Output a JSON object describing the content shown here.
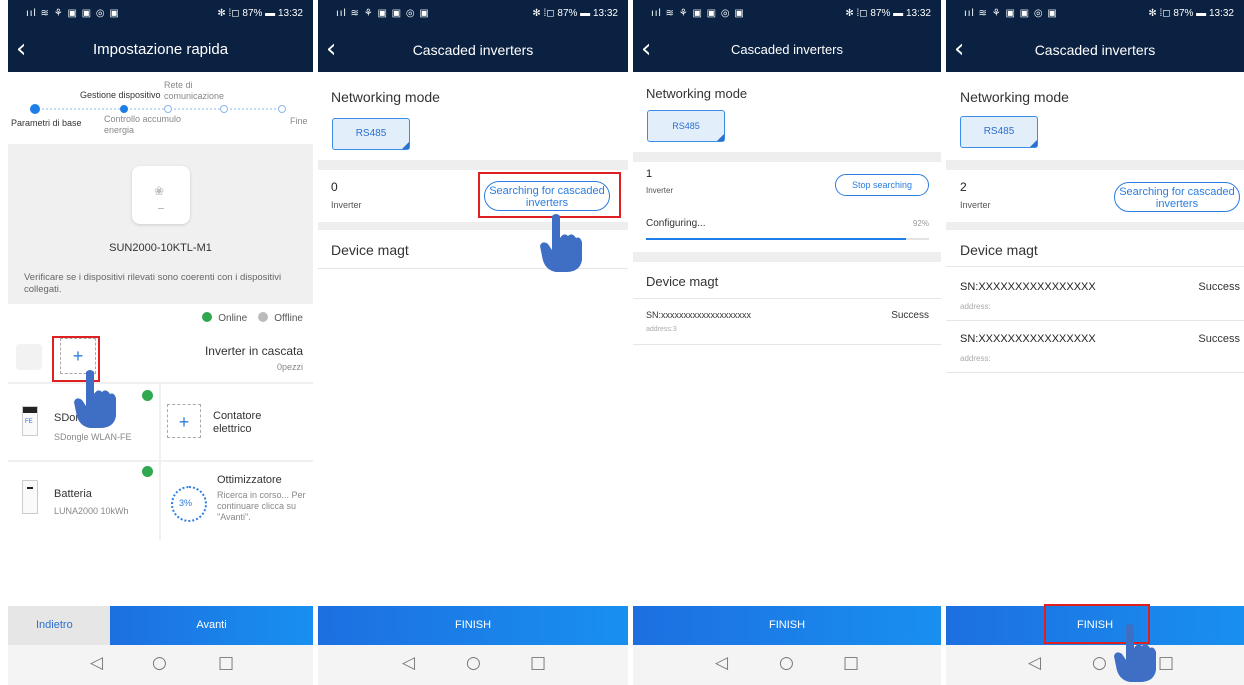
{
  "status_bar": {
    "left_icons": "ııl ≋ ⚘ ▣ ▣ ◎ ▣",
    "right": "✻ ⁞◻ 87% ▬ 13:32"
  },
  "screen1": {
    "title": "Impostazione rapida",
    "steps": {
      "step1": "Parametri di base",
      "step2": "Gestione dispositivo",
      "step3": "Controllo accumulo energia",
      "step4": "Rete di comunicazione",
      "step5": "Fine"
    },
    "device_name": "SUN2000-10KTL-M1",
    "device_desc": "Verificare se i dispositivi rilevati sono coerenti con i dispositivi collegati.",
    "legend_online": "Online",
    "legend_offline": "Offline",
    "cascade_title": "Inverter in cascata",
    "cascade_count": "0pezzi",
    "sdongle_title": "SDongle",
    "sdongle_sub": "SDongle WLAN-FE",
    "sdongle_icon_text": "FE",
    "meter_title": "Contatore elettrico",
    "battery_title": "Batteria",
    "battery_sub": "LUNA2000 10kWh",
    "optimizer_title": "Ottimizzatore",
    "optimizer_percent": "3%",
    "optimizer_desc": "Ricerca in corso... Per continuare clicca su \"Avanti\".",
    "back_button": "Indietro",
    "next_button": "Avanti"
  },
  "screen2": {
    "title": "Cascaded inverters",
    "networking_mode": "Networking mode",
    "mode_value": "RS485",
    "count": "0",
    "count_label": "Inverter",
    "search_button": "Searching for cascaded inverters",
    "device_magt": "Device magt",
    "finish": "FINISH"
  },
  "screen3": {
    "title": "Cascaded inverters",
    "networking_mode": "Networking mode",
    "mode_value": "RS485",
    "count": "1",
    "count_label": "Inverter",
    "stop_button": "Stop searching",
    "configuring": "Configuring...",
    "progress_text": "92%",
    "progress": 0.92,
    "device_magt": "Device magt",
    "sn": "SN:xxxxxxxxxxxxxxxxxxxx",
    "status": "Success",
    "address": "address:3",
    "finish": "FINISH"
  },
  "screen4": {
    "title": "Cascaded inverters",
    "networking_mode": "Networking mode",
    "mode_value": "RS485",
    "count": "2",
    "count_label": "Inverter",
    "search_button": "Searching for cascaded inverters",
    "device_magt": "Device magt",
    "rows": [
      {
        "sn": "SN:XXXXXXXXXXXXXXXX",
        "status": "Success",
        "address": "address:"
      },
      {
        "sn": "SN:XXXXXXXXXXXXXXXX",
        "status": "Success",
        "address": "address:"
      }
    ],
    "finish": "FINISH"
  },
  "nav": {
    "back": "◁",
    "home": "○",
    "recent": "□"
  },
  "colors": {
    "header": "#0a2141",
    "accent": "#1d7ee8",
    "highlight": "#e02020",
    "online": "#2fa84f",
    "offline": "#bbbbbb"
  }
}
